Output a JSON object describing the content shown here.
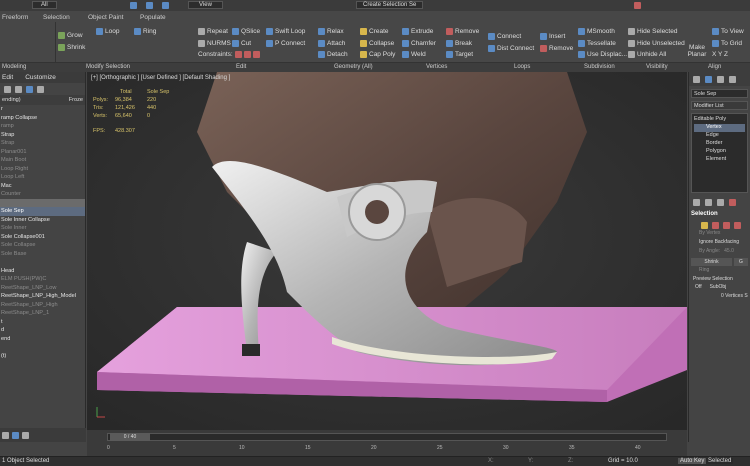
{
  "ribbon": {
    "tabs": [
      "Freeform",
      "Selection",
      "Object Paint",
      "Populate"
    ],
    "top_dropdowns": {
      "left": "All",
      "view": "View",
      "selection_set": "Create Selection Se"
    },
    "polygon_modeling": [
      "Grow",
      "Shrink"
    ],
    "loops_mod": [
      "Loop",
      "Ring"
    ],
    "geometry_all": [
      [
        "Repeat",
        "QSlice",
        "Swift Loop",
        "Relax",
        "Create"
      ],
      [
        "NURMS",
        "Cut",
        "P Connect",
        "Attach",
        "Collapse"
      ],
      [
        "Constraints:",
        "",
        "",
        "Detach",
        "Cap Poly"
      ]
    ],
    "vertices": [
      [
        "Extrude",
        "Remove"
      ],
      [
        "Chamfer",
        "Break"
      ],
      [
        "Weld",
        "Target"
      ]
    ],
    "loops": [
      [
        "Connect",
        "Insert"
      ],
      [
        "Dist Connect",
        "Remove"
      ]
    ],
    "subdivision": [
      "MSmooth",
      "Tessellate",
      "Use Displac..."
    ],
    "visibility": [
      "Hide Selected",
      "Hide Unselected",
      "Unhide All"
    ],
    "align": [
      "Make Planar",
      "To View",
      "To Grid",
      "X  Y  Z"
    ],
    "group_labels": [
      "Modeling",
      "Modify Selection",
      "Edit",
      "Geometry (All)",
      "Vertices",
      "Loops",
      "Subdivision",
      "Visibility",
      "Align"
    ]
  },
  "left_panel": {
    "tabs": [
      "Edit",
      "Customize"
    ],
    "sort_label": "ending)",
    "sort_right": "Froze",
    "rows": [
      {
        "t": "r",
        "s": ""
      },
      {
        "t": "ramp Collapse",
        "s": ""
      },
      {
        "t": "ramp",
        "s": "dim"
      },
      {
        "t": "Strap",
        "s": ""
      },
      {
        "t": "Strap",
        "s": "dim"
      },
      {
        "t": "Planar001",
        "s": "dim"
      },
      {
        "t": "Main Boot",
        "s": "dim"
      },
      {
        "t": "Loop Right",
        "s": "dim"
      },
      {
        "t": "Loop Left",
        "s": "dim"
      },
      {
        "t": "Mac",
        "s": ""
      },
      {
        "t": "Counter",
        "s": "dim"
      },
      {
        "t": "",
        "s": "sel2"
      },
      {
        "t": "Sole Sep",
        "s": "sel"
      },
      {
        "t": "Sole Inner Collapse",
        "s": ""
      },
      {
        "t": "Sole Inner",
        "s": "dim"
      },
      {
        "t": "Sole Collapse001",
        "s": ""
      },
      {
        "t": "Sole Collapse",
        "s": "dim"
      },
      {
        "t": "Sole Base",
        "s": "dim"
      },
      {
        "t": "",
        "s": ""
      },
      {
        "t": "Head",
        "s": ""
      },
      {
        "t": "ELM PUSH(PW)C",
        "s": "dim"
      },
      {
        "t": "ReetShape_LNP_Low",
        "s": "dim"
      },
      {
        "t": "ReetShape_LNP_High_Model",
        "s": ""
      },
      {
        "t": "ReetShape_LNP_High",
        "s": "dim"
      },
      {
        "t": "ReetShape_LNP_1",
        "s": "dim"
      },
      {
        "t": "t",
        "s": ""
      },
      {
        "t": "d",
        "s": ""
      },
      {
        "t": "end",
        "s": ""
      },
      {
        "t": "",
        "s": ""
      },
      {
        "t": "(t)",
        "s": ""
      }
    ]
  },
  "viewport": {
    "label": "[+] [Orthographic ] [User Defined ] [Default Shading ]",
    "stats": {
      "head": [
        "",
        "Total",
        "Sole Sep"
      ],
      "rows": [
        [
          "Polys:",
          "96,384",
          "220"
        ],
        [
          "Tris:",
          "121,426",
          "440"
        ],
        [
          "Verts:",
          "65,640",
          "0"
        ]
      ],
      "fps_label": "FPS:",
      "fps": "428.307"
    },
    "colors": {
      "platform": "#d88fd0",
      "shoe": "#c8c8c8"
    }
  },
  "right_panel": {
    "object_name": "Sole Sep",
    "modifier_list": "Modifier List",
    "stack": [
      "Editable Poly",
      "Vertex",
      "Edge",
      "Border",
      "Polygon",
      "Element"
    ],
    "selection_title": "Selection",
    "by_vertex": "By Vertex",
    "ignore_backfacing": "Ignore Backfacing",
    "by_angle": "By Angle:",
    "angle_value": "45.0",
    "shrink": "Shrink",
    "grow": "G",
    "ring": "Ring",
    "preview": "Preview Selection",
    "off": "Off",
    "subobj": "SubObj",
    "status": "0 Vertices S"
  },
  "timeline": {
    "frame": "0 / 40",
    "ticks": [
      "0",
      "5",
      "10",
      "15",
      "20",
      "25",
      "30",
      "35",
      "40"
    ]
  },
  "status": {
    "left": "1 Object Selected",
    "grid": "Grid = 10.0",
    "autokey": "Auto Key",
    "selected": "Selected",
    "x": "X:",
    "y": "Y:",
    "z": "Z:"
  }
}
